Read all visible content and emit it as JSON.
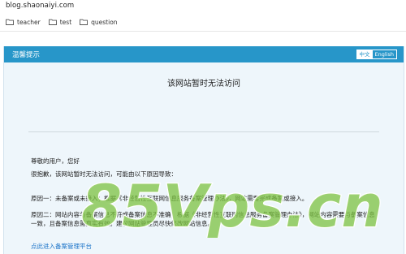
{
  "browser": {
    "url": "blog.shaonaiyi.com",
    "bookmarks": [
      {
        "label": "teacher",
        "icon": "folder-icon"
      },
      {
        "label": "test",
        "icon": "folder-icon"
      },
      {
        "label": "question",
        "icon": "folder-icon"
      }
    ]
  },
  "notice": {
    "header_title": "温馨提示",
    "lang_options": [
      {
        "label": "中文",
        "active": true
      },
      {
        "label": "English",
        "active": false
      }
    ],
    "title": "该网站暂时无法访问",
    "greeting": "尊敬的用户，您好",
    "intro": "很抱歉，该网站暂时无法访问，可能由以下原因导致：",
    "reason_1": "原因一：未备案或未接入；根据《非经营性互联网信息服务备案管理办法》，网站需要完成备案或接入。",
    "reason_2": "原因二：网站内容与备案信息不符或备案信息不准确；根据《非经营性互联网信息服务备案管理办法》，网站内容需要与备案信息一致，且备案信息需真实有效。建议网站管理员尽快修改网站信息。",
    "link_label": "点此进入备案管理平台"
  },
  "watermark": {
    "text": "85Vps.cn",
    "color": "#7cc242"
  },
  "colors": {
    "header_blue": "#2796c9",
    "panel_bg": "#eef6fb",
    "link_blue": "#1a73c8"
  }
}
